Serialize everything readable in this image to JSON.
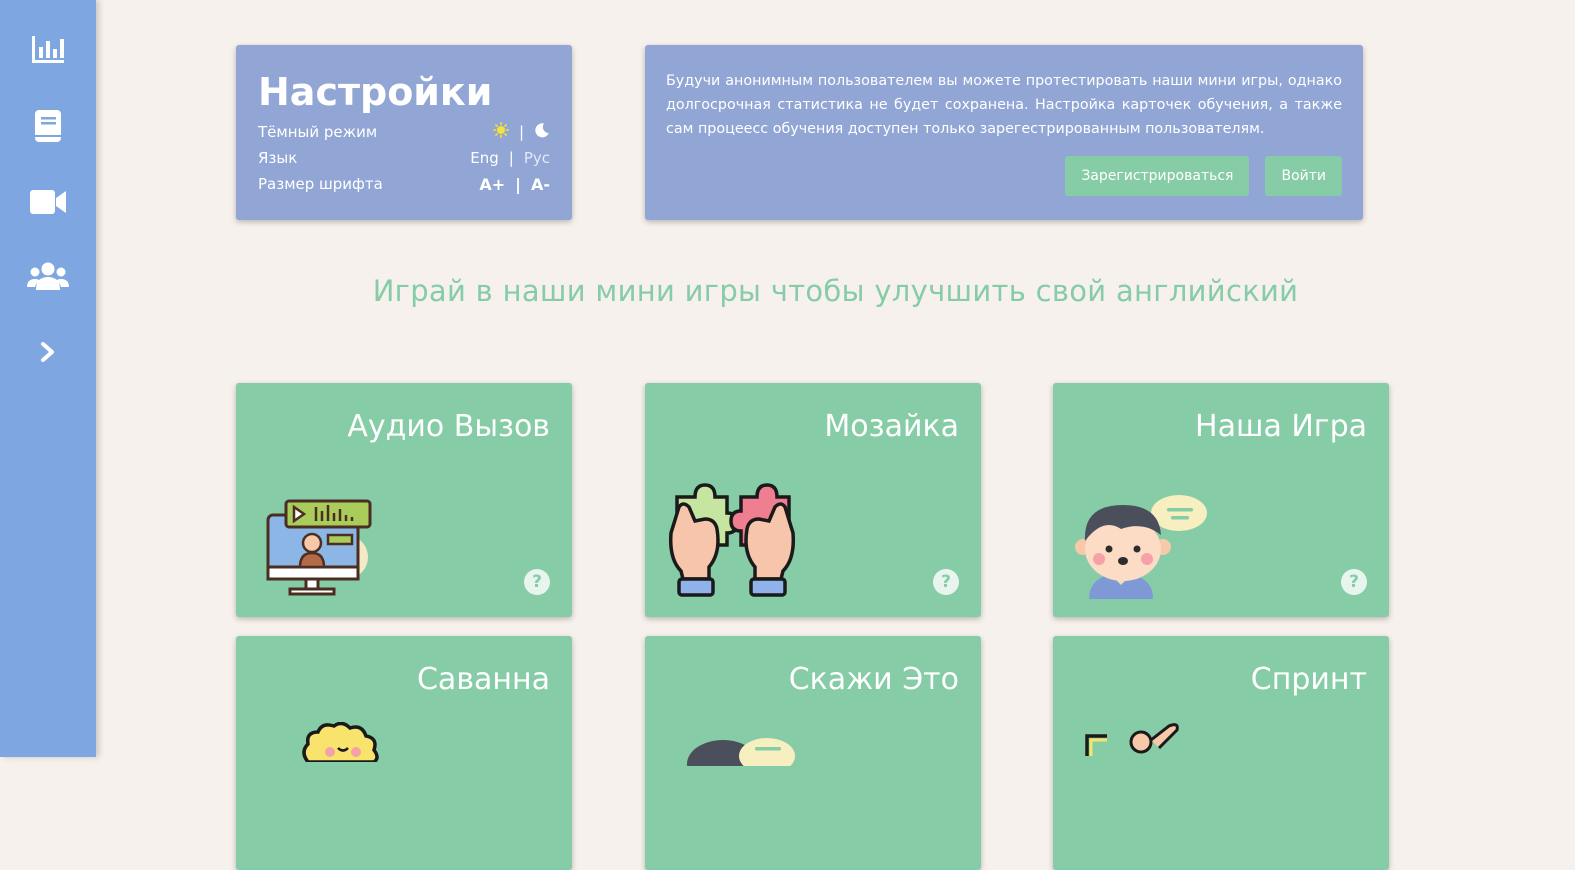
{
  "sidebar": {
    "items": [
      {
        "icon": "chart-bar-icon"
      },
      {
        "icon": "book-icon"
      },
      {
        "icon": "video-icon"
      },
      {
        "icon": "users-icon"
      },
      {
        "icon": "chevron-right-icon"
      }
    ]
  },
  "settings": {
    "title": "Настройки",
    "dark_mode_label": "Тёмный режим",
    "language_label": "Язык",
    "lang_eng": "Eng",
    "lang_rus": "Рус",
    "font_size_label": "Размер шрифта",
    "font_inc": "A+",
    "font_dec": "A-",
    "separator": "|"
  },
  "info": {
    "text": "Будучи анонимным пользователем вы можете протестировать наши мини игры, однако долгосрочная статистика не будет сохранена. Настройка карточек обучения, а также сам процеесс обучения доступен только зарегестрированным пользователям.",
    "register_label": "Зарегистрироваться",
    "login_label": "Войти"
  },
  "headline": "Играй в наши мини игры чтобы улучшить свой английский",
  "games": [
    {
      "title": "Аудио Вызов",
      "help": "?"
    },
    {
      "title": "Мозайка",
      "help": "?"
    },
    {
      "title": "Наша Игра",
      "help": "?"
    },
    {
      "title": "Саванна"
    },
    {
      "title": "Скажи Это"
    },
    {
      "title": "Спринт"
    }
  ],
  "colors": {
    "sidebar": "#7ea6e0",
    "panel": "#91a6d4",
    "accent": "#86cca6",
    "background": "#f7f1ed"
  }
}
